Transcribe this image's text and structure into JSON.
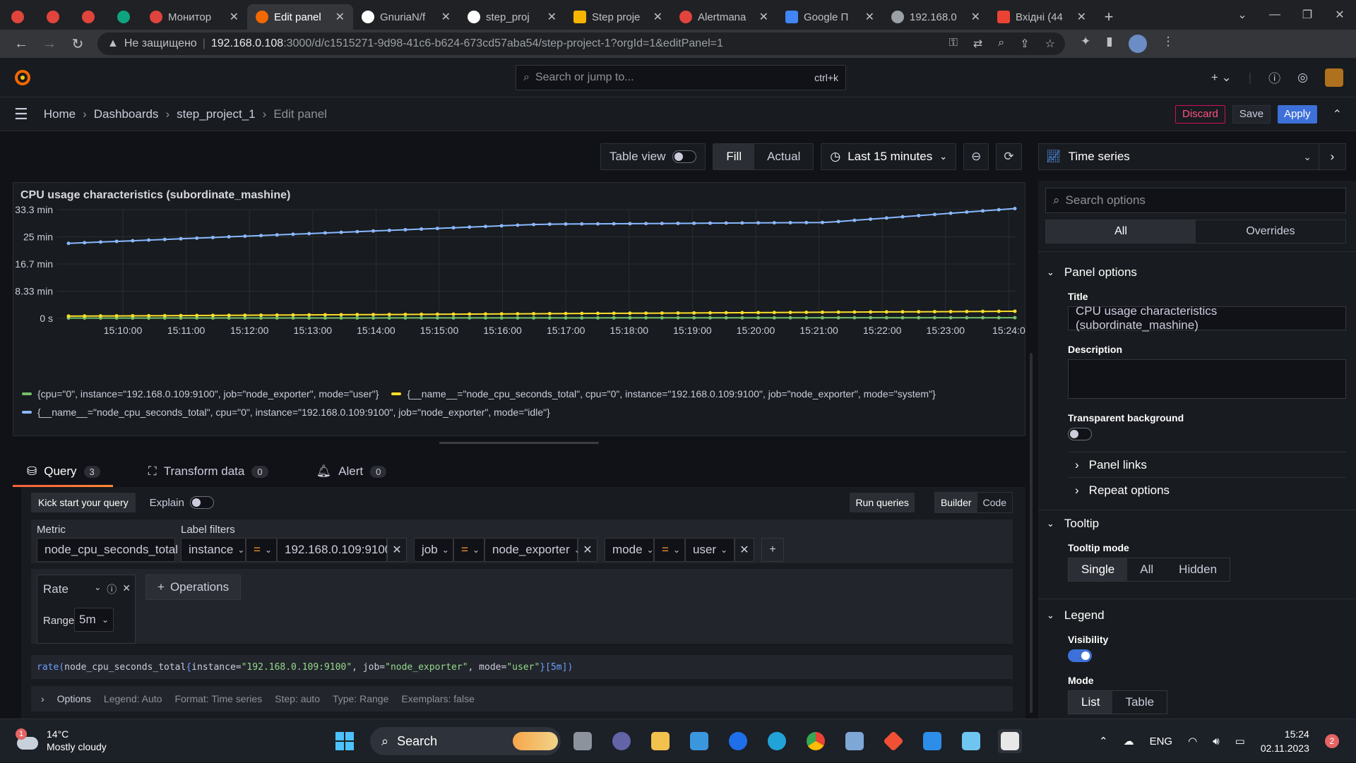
{
  "browser": {
    "tabs": [
      {
        "label": "",
        "color": "#e0443c"
      },
      {
        "label": "",
        "color": "#e0443c"
      },
      {
        "label": "",
        "color": "#e0443c"
      },
      {
        "label": "",
        "color": "#10a37f"
      },
      {
        "label": "Монитор",
        "color": "#e0443c"
      },
      {
        "label": "Edit panel",
        "color": "#f46800"
      },
      {
        "label": "GnuriaN/f",
        "color": "#ffffff"
      },
      {
        "label": "step_proj",
        "color": "#ffffff"
      },
      {
        "label": "Step proje",
        "color": "#f4b400"
      },
      {
        "label": "Alertmana",
        "color": "#e0443c"
      },
      {
        "label": "Google П",
        "color": "#4285f4"
      },
      {
        "label": "192.168.0",
        "color": "#9aa0a6"
      },
      {
        "label": "Вхідні (44",
        "color": "#ea4335"
      }
    ],
    "security": "Не защищено",
    "url_host": "192.168.0.108",
    "url_path": ":3000/d/c1515271-9d98-41c6-b624-673cd57aba54/step-project-1?orgId=1&editPanel=1"
  },
  "grafana": {
    "search_placeholder": "Search or jump to...",
    "search_kbd": "ctrl+k",
    "breadcrumb": [
      "Home",
      "Dashboards",
      "step_project_1",
      "Edit panel"
    ],
    "discard": "Discard",
    "save": "Save",
    "apply": "Apply"
  },
  "toolbar": {
    "table_view": "Table view",
    "fill": "Fill",
    "actual": "Actual",
    "time_range": "Last 15 minutes"
  },
  "panel": {
    "title": "CPU usage characteristics (subordinate_mashine)"
  },
  "chart_data": {
    "type": "line",
    "y_ticks": [
      "0 s",
      "8.33 min",
      "16.7 min",
      "25 min",
      "33.3 min"
    ],
    "y_tick_values": [
      0,
      500,
      1000,
      1500,
      2000
    ],
    "ylim": [
      0,
      2000
    ],
    "x_ticks": [
      "15:10:00",
      "15:11:00",
      "15:12:00",
      "15:13:00",
      "15:14:00",
      "15:15:00",
      "15:16:00",
      "15:17:00",
      "15:18:00",
      "15:19:00",
      "15:20:00",
      "15:21:00",
      "15:22:00",
      "15:23:00",
      "15:24:0"
    ],
    "grid": true,
    "legend_position": "bottom",
    "series": [
      {
        "name": "{cpu=\"0\", instance=\"192.168.0.109:9100\", job=\"node_exporter\", mode=\"user\"}",
        "color": "#73bf69",
        "start": 5,
        "end": 12
      },
      {
        "name": "{__name__=\"node_cpu_seconds_total\", cpu=\"0\", instance=\"192.168.0.109:9100\", job=\"node_exporter\", mode=\"system\"}",
        "color": "#fade2a",
        "start": 40,
        "end": 130
      },
      {
        "name": "{__name__=\"node_cpu_seconds_total\", cpu=\"0\", instance=\"192.168.0.109:9100\", job=\"node_exporter\", mode=\"idle\"}",
        "color": "#8ab8ff",
        "start": 1380,
        "end": 2020
      }
    ]
  },
  "query_tabs": [
    {
      "label": "Query",
      "count": "3"
    },
    {
      "label": "Transform data",
      "count": "0"
    },
    {
      "label": "Alert",
      "count": "0"
    }
  ],
  "query": {
    "kick_start": "Kick start your query",
    "explain": "Explain",
    "run": "Run queries",
    "builder": "Builder",
    "code": "Code",
    "metric_label": "Metric",
    "metric": "node_cpu_seconds_total",
    "label_filters_label": "Label filters",
    "filters": [
      {
        "key": "instance",
        "op": "=",
        "value": "192.168.0.109:9100"
      },
      {
        "key": "job",
        "op": "=",
        "value": "node_exporter"
      },
      {
        "key": "mode",
        "op": "=",
        "value": "user"
      }
    ],
    "rate": "Rate",
    "range_label": "Range",
    "range": "5m",
    "operations": "Operations",
    "promql": {
      "fn": "rate(",
      "metric": "node_cpu_seconds_total",
      "lb": "{",
      "k1": "instance=",
      "v1": "\"192.168.0.109:9100\"",
      "k2": ", job=",
      "v2": "\"node_exporter\"",
      "k3": ", mode=",
      "v3": "\"user\"",
      "rb": "}",
      "range": "[5m]",
      "close": ")"
    },
    "options": "Options",
    "legend": "Legend: Auto",
    "format": "Format: Time series",
    "step": "Step: auto",
    "qtype": "Type: Range",
    "exemplars": "Exemplars: false"
  },
  "options_pane": {
    "viz": "Time series",
    "search_placeholder": "Search options",
    "all": "All",
    "overrides": "Overrides",
    "panel_options": "Panel options",
    "title_label": "Title",
    "title_value": "CPU usage characteristics (subordinate_mashine)",
    "description_label": "Description",
    "transparent_label": "Transparent background",
    "panel_links": "Panel links",
    "repeat_options": "Repeat options",
    "tooltip": "Tooltip",
    "tooltip_mode_label": "Tooltip mode",
    "tooltip_modes": [
      "Single",
      "All",
      "Hidden"
    ],
    "legend": "Legend",
    "visibility_label": "Visibility",
    "mode_label": "Mode",
    "legend_modes": [
      "List",
      "Table"
    ]
  },
  "taskbar": {
    "weather_badge": "1",
    "temp": "14°C",
    "condition": "Mostly cloudy",
    "search": "Search",
    "lang": "ENG",
    "time": "15:24",
    "date": "02.11.2023",
    "notifications": "2"
  }
}
